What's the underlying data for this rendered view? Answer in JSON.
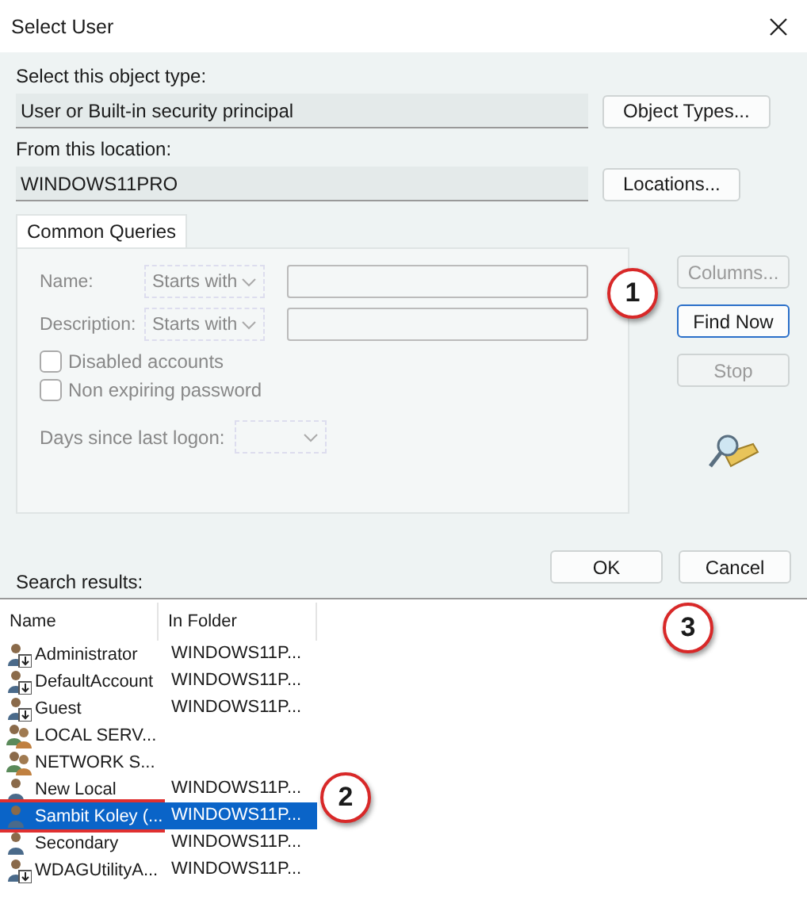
{
  "window": {
    "title": "Select User"
  },
  "object_type": {
    "label": "Select this object type:",
    "value": "User or Built-in security principal",
    "button": "Object Types..."
  },
  "location": {
    "label": "From this location:",
    "value": "WINDOWS11PRO",
    "button": "Locations..."
  },
  "tabs": [
    {
      "label": "Common Queries",
      "selected": true
    }
  ],
  "queries": {
    "disabled": true,
    "fields": [
      {
        "label": "Name:",
        "operator": "Starts with"
      },
      {
        "label": "Description:",
        "operator": "Starts with"
      }
    ],
    "checkboxes": [
      {
        "label": "Disabled accounts",
        "checked": false
      },
      {
        "label": "Non expiring password",
        "checked": false
      }
    ],
    "days_label": "Days since last logon:"
  },
  "side_buttons": [
    {
      "label": "Columns...",
      "disabled": true,
      "default": false
    },
    {
      "label": "Find Now",
      "disabled": false,
      "default": true
    },
    {
      "label": "Stop",
      "disabled": true,
      "default": false
    }
  ],
  "search_results_label": "Search results:",
  "dialog_buttons": [
    {
      "label": "OK"
    },
    {
      "label": "Cancel"
    }
  ],
  "results": {
    "columns": [
      "Name",
      "In Folder"
    ],
    "rows": [
      {
        "name": "Administrator",
        "folder": "WINDOWS11P...",
        "kind": "disabled_user",
        "selected": false
      },
      {
        "name": "DefaultAccount",
        "folder": "WINDOWS11P...",
        "kind": "disabled_user",
        "selected": false
      },
      {
        "name": "Guest",
        "folder": "WINDOWS11P...",
        "kind": "disabled_user",
        "selected": false
      },
      {
        "name": "LOCAL SERV...",
        "folder": "",
        "kind": "group",
        "selected": false
      },
      {
        "name": "NETWORK S...",
        "folder": "",
        "kind": "group",
        "selected": false
      },
      {
        "name": "New Local",
        "folder": "WINDOWS11P...",
        "kind": "user",
        "selected": false
      },
      {
        "name": "Sambit Koley (...",
        "folder": "WINDOWS11P...",
        "kind": "user",
        "selected": true
      },
      {
        "name": "Secondary",
        "folder": "WINDOWS11P...",
        "kind": "user",
        "selected": false
      },
      {
        "name": "WDAGUtilityA...",
        "folder": "WINDOWS11P...",
        "kind": "disabled_user",
        "selected": false
      }
    ]
  },
  "callouts": [
    {
      "number": "1"
    },
    {
      "number": "2"
    },
    {
      "number": "3"
    }
  ]
}
